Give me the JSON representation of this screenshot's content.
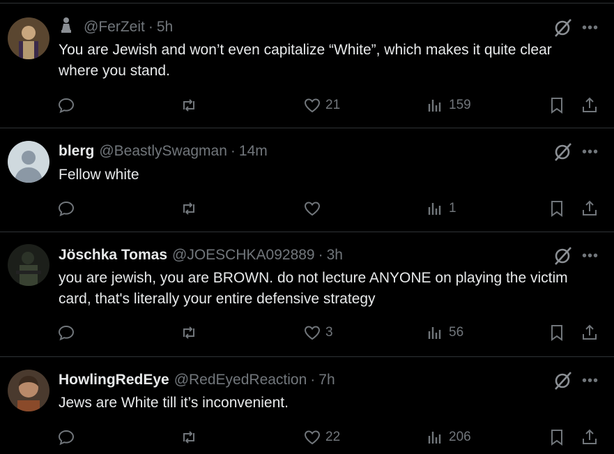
{
  "posts": [
    {
      "name": "",
      "handle": "@FerZeit",
      "time": "5h",
      "text": "You are Jewish and won’t even capitalize “White”,  which makes it quite clear where you stand.",
      "replies": "",
      "reposts": "",
      "likes": "21",
      "views": "159",
      "avatar": "painting-portrait",
      "badge_icon": "chess-pawn-icon"
    },
    {
      "name": "blerg",
      "handle": "@BeastlySwagman",
      "time": "14m",
      "text": "Fellow white",
      "replies": "",
      "reposts": "",
      "likes": "",
      "views": "1",
      "avatar": "default-avatar"
    },
    {
      "name": "Jöschka Tomas",
      "handle": "@JOESCHKA092889",
      "time": "3h",
      "text": "you are jewish, you are BROWN. do not lecture ANYONE on playing the victim card, that's literally your entire defensive strategy",
      "replies": "",
      "reposts": "",
      "likes": "3",
      "views": "56",
      "avatar": "soldier-photo"
    },
    {
      "name": "HowlingRedEye",
      "handle": "@RedEyedReaction",
      "time": "7h",
      "text": "Jews are White till it’s inconvenient.",
      "replies": "",
      "reposts": "",
      "likes": "22",
      "views": "206",
      "avatar": "person-photo"
    }
  ],
  "ui": {
    "separator": "·",
    "more": "•••"
  },
  "colors": {
    "background": "#000000",
    "text": "#e7e9ea",
    "muted": "#71767b",
    "divider": "#2f3336"
  }
}
